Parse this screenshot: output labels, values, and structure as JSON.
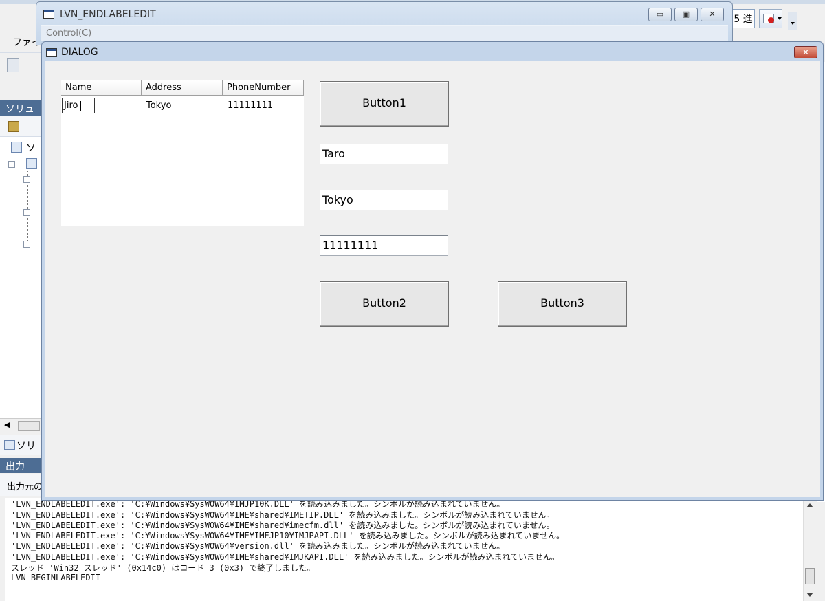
{
  "ide": {
    "menu_label": "ファイ",
    "base_label": "5 進",
    "solution_header": "ソリュ",
    "tree_item": "ソ",
    "solution_tab": "ソリ",
    "output_header": "出力",
    "output_source": "出力元の",
    "output_lines": [
      "'LVN_ENDLABELEDIT.exe': 'C:¥Windows¥SysWOW64¥IMJP10K.DLL' を読み込みました。シンボルが読み込まれていません。",
      "'LVN_ENDLABELEDIT.exe': 'C:¥Windows¥SysWOW64¥IME¥shared¥IMETIP.DLL' を読み込みました。シンボルが読み込まれていません。",
      "'LVN_ENDLABELEDIT.exe': 'C:¥Windows¥SysWOW64¥IME¥shared¥imecfm.dll' を読み込みました。シンボルが読み込まれていません。",
      "'LVN_ENDLABELEDIT.exe': 'C:¥Windows¥SysWOW64¥IME¥IMEJP10¥IMJPAPI.DLL' を読み込みました。シンボルが読み込まれていません。",
      "'LVN_ENDLABELEDIT.exe': 'C:¥Windows¥SysWOW64¥version.dll' を読み込みました。シンボルが読み込まれていません。",
      "'LVN_ENDLABELEDIT.exe': 'C:¥Windows¥SysWOW64¥IME¥shared¥IMJKAPI.DLL' を読み込みました。シンボルが読み込まれていません。",
      "スレッド 'Win32 スレッド' (0x14c0) はコード 3 (0x3) で終了しました。",
      "LVN_BEGINLABELEDIT"
    ]
  },
  "lvn_window": {
    "title": "LVN_ENDLABELEDIT",
    "menu": "Control(C)"
  },
  "dialog": {
    "title": "DIALOG",
    "list": {
      "columns": [
        "Name",
        "Address",
        "PhoneNumber"
      ],
      "rows": [
        {
          "name": "Jiro",
          "address": "Tokyo",
          "phone": "11111111"
        }
      ]
    },
    "button1": "Button1",
    "button2": "Button2",
    "button3": "Button3",
    "name_value": "Taro",
    "address_value": "Tokyo",
    "phone_value": "11111111"
  }
}
